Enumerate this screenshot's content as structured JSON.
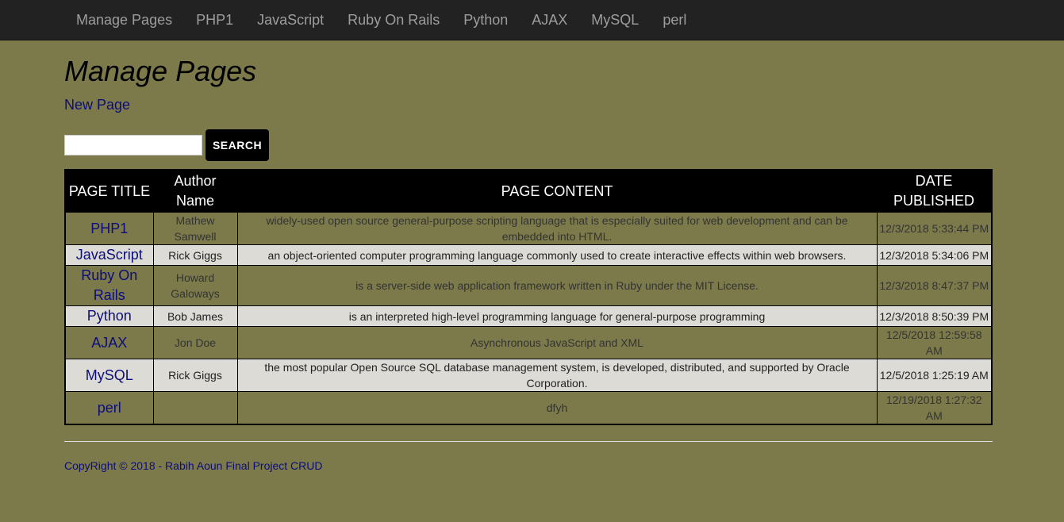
{
  "nav": {
    "items": [
      "Manage Pages",
      "PHP1",
      "JavaScript",
      "Ruby On Rails",
      "Python",
      "AJAX",
      "MySQL",
      "perl"
    ]
  },
  "page_title": "Manage Pages",
  "new_page_label": "New Page",
  "search": {
    "value": "",
    "button_label": "SEARCH"
  },
  "table": {
    "headers": [
      "PAGE TITLE",
      "Author Name",
      "PAGE CONTENT",
      "DATE PUBLISHED"
    ],
    "rows": [
      {
        "title": "PHP1",
        "author": "Mathew Samwell",
        "content": "widely-used open source general-purpose scripting language that is especially suited for web development and can be embedded into HTML.",
        "date": "12/3/2018 5:33:44 PM"
      },
      {
        "title": "JavaScript",
        "author": "Rick Giggs",
        "content": "an object-oriented computer programming language commonly used to create interactive effects within web browsers.",
        "date": "12/3/2018 5:34:06 PM"
      },
      {
        "title": "Ruby On Rails",
        "author": "Howard Galoways",
        "content": "is a server-side web application framework written in Ruby under the MIT License.",
        "date": "12/3/2018 8:47:37 PM"
      },
      {
        "title": "Python",
        "author": "Bob James",
        "content": "is an interpreted high-level programming language for general-purpose programming",
        "date": "12/3/2018 8:50:39 PM"
      },
      {
        "title": "AJAX",
        "author": "Jon Doe",
        "content": "Asynchronous JavaScript and XML",
        "date": "12/5/2018 12:59:58 AM"
      },
      {
        "title": "MySQL",
        "author": "Rick Giggs",
        "content": "the most popular Open Source SQL database management system, is developed, distributed, and supported by Oracle Corporation.",
        "date": "12/5/2018 1:25:19 AM"
      },
      {
        "title": "perl",
        "author": "",
        "content": "dfyh",
        "date": "12/19/2018 1:27:32 AM"
      }
    ]
  },
  "footer": "CopyRight © 2018 - Rabih Aoun Final Project CRUD",
  "colors": {
    "background": "#7c7a4a",
    "navbar": "#222222",
    "link": "#0d0d7a",
    "row_alt": "#dcdbd6"
  }
}
